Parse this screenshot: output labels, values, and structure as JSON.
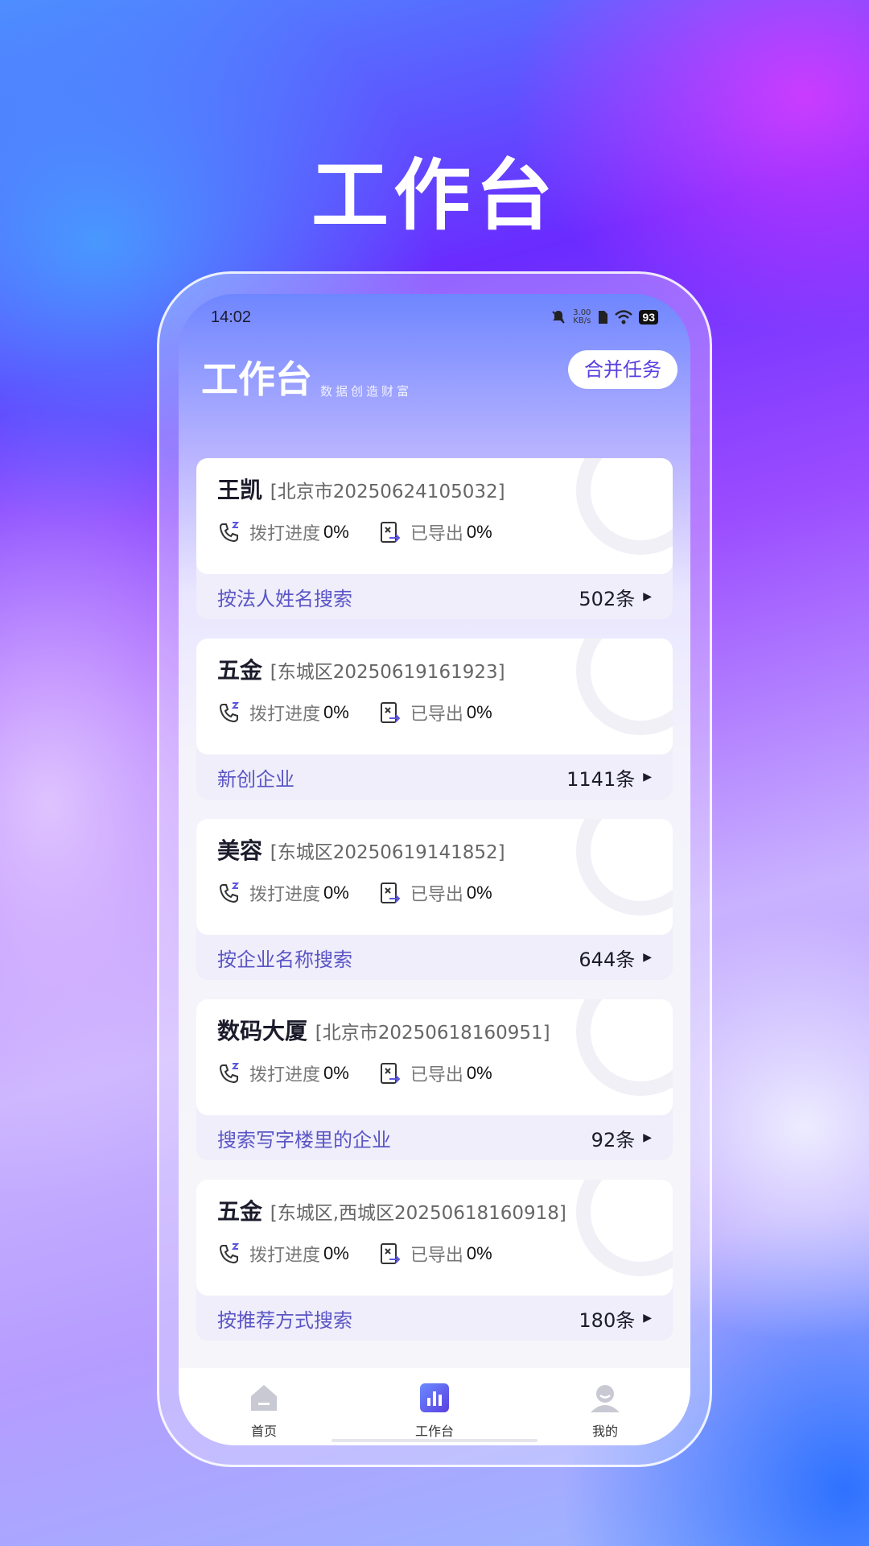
{
  "hero": {
    "title": "工作台"
  },
  "status_bar": {
    "time": "14:02",
    "net_speed_value": "3.00",
    "net_speed_unit": "KB/s",
    "battery": "93"
  },
  "header": {
    "title": "工作台",
    "slogan": "数据创造财富",
    "merge_button": "合并任务"
  },
  "tasks": [
    {
      "name": "王凯",
      "meta": "[北京市20250624105032]",
      "dial_label": "拨打进度",
      "dial_value": "0%",
      "export_label": "已导出",
      "export_value": "0%",
      "type": "按法人姓名搜索",
      "count": "502条"
    },
    {
      "name": "五金",
      "meta": "[东城区20250619161923]",
      "dial_label": "拨打进度",
      "dial_value": "0%",
      "export_label": "已导出",
      "export_value": "0%",
      "type": "新创企业",
      "count": "1141条"
    },
    {
      "name": "美容",
      "meta": "[东城区20250619141852]",
      "dial_label": "拨打进度",
      "dial_value": "0%",
      "export_label": "已导出",
      "export_value": "0%",
      "type": "按企业名称搜索",
      "count": "644条"
    },
    {
      "name": "数码大厦",
      "meta": "[北京市20250618160951]",
      "dial_label": "拨打进度",
      "dial_value": "0%",
      "export_label": "已导出",
      "export_value": "0%",
      "type": "搜索写字楼里的企业",
      "count": "92条"
    },
    {
      "name": "五金",
      "meta": "[东城区,西城区20250618160918]",
      "dial_label": "拨打进度",
      "dial_value": "0%",
      "export_label": "已导出",
      "export_value": "0%",
      "type": "按推荐方式搜索",
      "count": "180条"
    }
  ],
  "tabs": [
    {
      "label": "首页",
      "icon": "home-icon"
    },
    {
      "label": "工作台",
      "icon": "chart-icon",
      "active": true
    },
    {
      "label": "我的",
      "icon": "user-icon"
    }
  ],
  "colors": {
    "accent": "#5a3fe0",
    "type_text": "#5b55c6"
  }
}
